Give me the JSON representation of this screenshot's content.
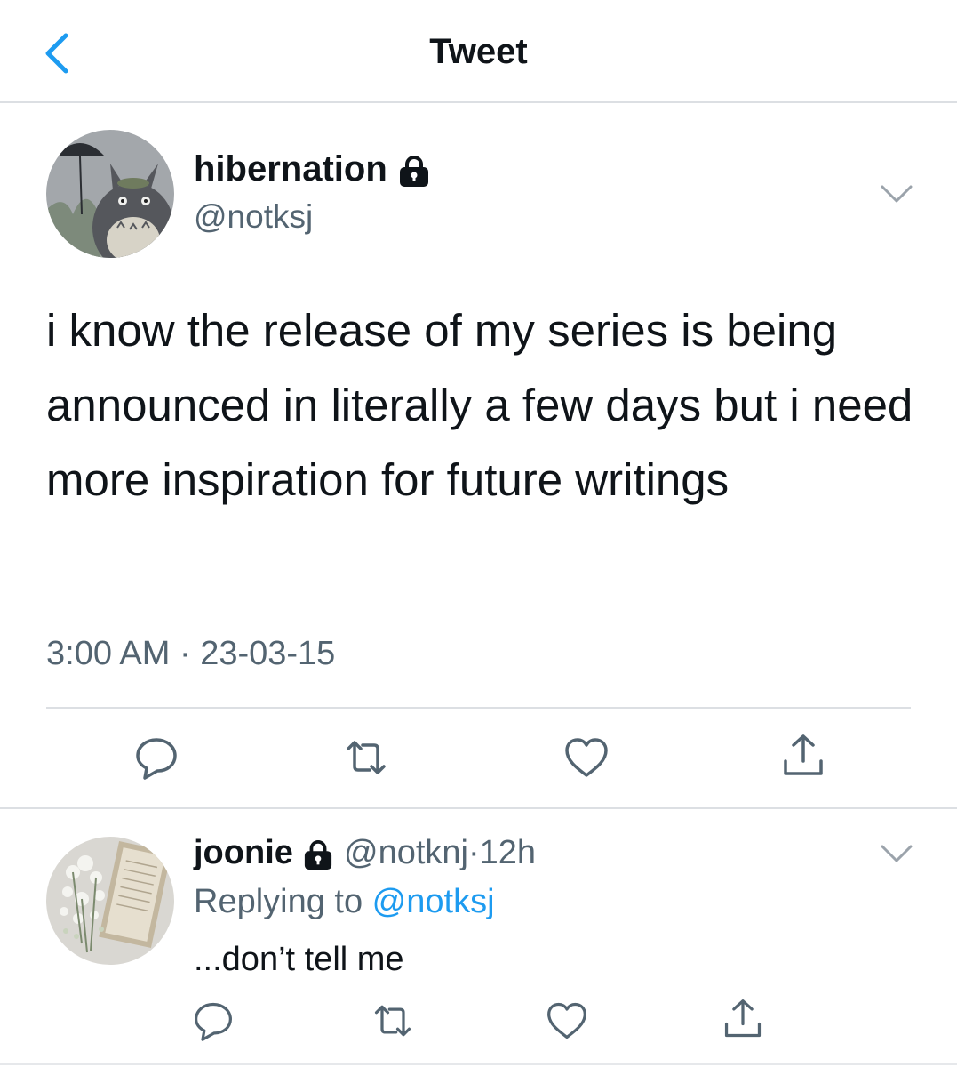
{
  "header": {
    "title": "Tweet",
    "back_icon": "chevron-left-icon"
  },
  "tweet": {
    "display_name": "hibernation",
    "handle": "@notksj",
    "text": "i know the release of my series is being announced in literally a few days but i need more inspiration for future writings",
    "timestamp": "3:00 AM · 23-03-15",
    "actions": [
      "reply-icon",
      "retweet-icon",
      "like-icon",
      "share-icon"
    ]
  },
  "reply": {
    "display_name": "joonie",
    "handle": "@notknj",
    "dot": "·",
    "time": "12h",
    "replying_label": "Replying to ",
    "replying_handle": "@notksj",
    "text": "...don’t tell me",
    "actions": [
      "reply-icon",
      "retweet-icon",
      "like-icon",
      "share-icon"
    ]
  },
  "colors": {
    "link": "#1d9bf0",
    "secondary": "#536471",
    "divider": "#dcdfe3"
  }
}
